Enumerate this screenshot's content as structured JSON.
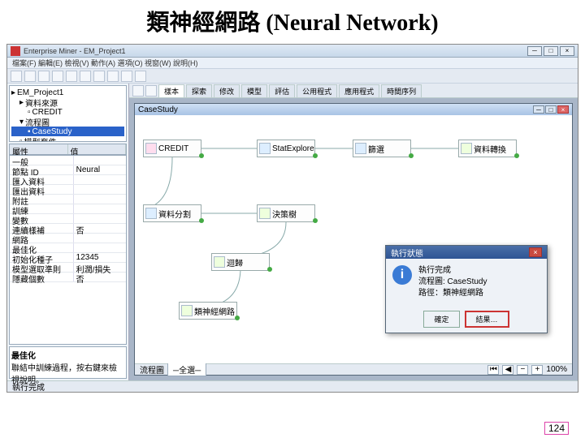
{
  "slide": {
    "title": "類神經網路 (Neural Network)",
    "page": "124"
  },
  "app": {
    "title": "Enterprise Miner - EM_Project1",
    "menu": "檔案(F) 編輯(E) 檢視(V) 動作(A) 選項(O) 視窗(W) 說明(H)"
  },
  "tree": {
    "root": "EM_Project1",
    "ds": "資料來源",
    "credit": "CREDIT",
    "diag": "流程圖",
    "cs": "CaseStudy",
    "model": "模型套件"
  },
  "props": {
    "head_k": "屬性",
    "head_v": "值",
    "rows": [
      {
        "k": "一般",
        "v": ""
      },
      {
        "k": "節點 ID",
        "v": "Neural"
      },
      {
        "k": "匯入資料",
        "v": ""
      },
      {
        "k": "匯出資料",
        "v": ""
      },
      {
        "k": "附註",
        "v": ""
      },
      {
        "k": "訓練",
        "v": ""
      },
      {
        "k": "變數",
        "v": ""
      },
      {
        "k": "連續樣補",
        "v": "否"
      },
      {
        "k": "網路",
        "v": ""
      },
      {
        "k": "最佳化",
        "v": ""
      },
      {
        "k": "初始化種子",
        "v": "12345"
      },
      {
        "k": "模型選取準則",
        "v": "利潤/損失"
      },
      {
        "k": "隱藏個數",
        "v": "否"
      }
    ]
  },
  "notes": {
    "head": "最佳化",
    "body": "聯結中訓練過程，按右鍵來檢視說明。"
  },
  "tabs": [
    "樣本",
    "探索",
    "修改",
    "模型",
    "評估",
    "公用程式",
    "應用程式",
    "時間序列"
  ],
  "inner": {
    "title": "CaseStudy"
  },
  "nodes": {
    "n1": "CREDIT",
    "n2": "StatExplore",
    "n3": "篩選",
    "n4": "資料轉換",
    "n5": "資料分割",
    "n6": "決策樹",
    "n7": "迴歸",
    "n8": "類神經網路"
  },
  "dialog": {
    "title": "執行狀態",
    "l1": "執行完成",
    "l2": "流程圖: CaseStudy",
    "l3": "路徑：類神經網路",
    "ok": "確定",
    "res": "結果…"
  },
  "zoom": {
    "label": "流程圖",
    "sel": "─全選─",
    "pct": "100%"
  },
  "status": "執行完成"
}
